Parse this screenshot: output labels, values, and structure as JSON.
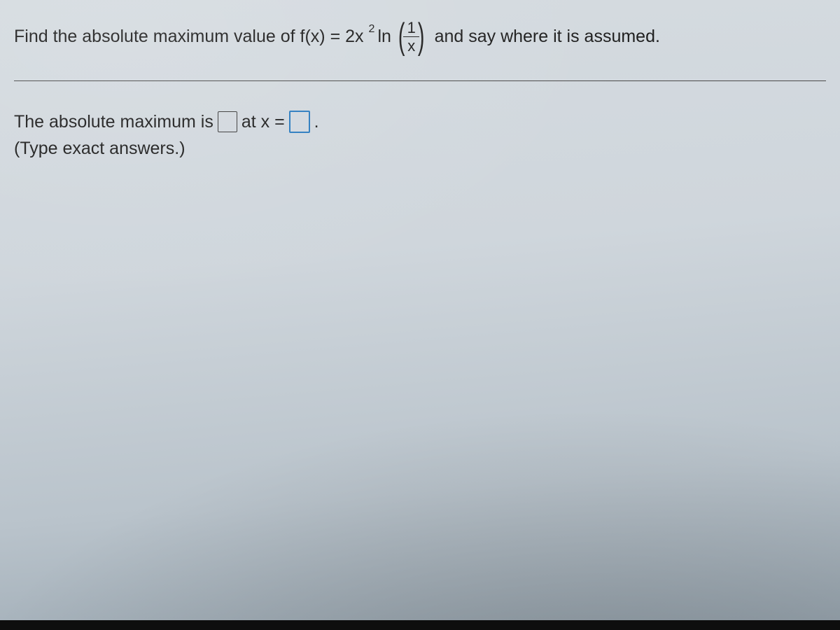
{
  "question": {
    "prefix": "Find the absolute maximum value of f(x) = 2x",
    "exponent": "2",
    "ln": " ln",
    "frac_num": "1",
    "frac_den": "x",
    "suffix": " and say where it is assumed."
  },
  "answer": {
    "lead": "The absolute maximum is",
    "mid": " at x =",
    "period": ".",
    "hint": "(Type exact answers.)"
  }
}
